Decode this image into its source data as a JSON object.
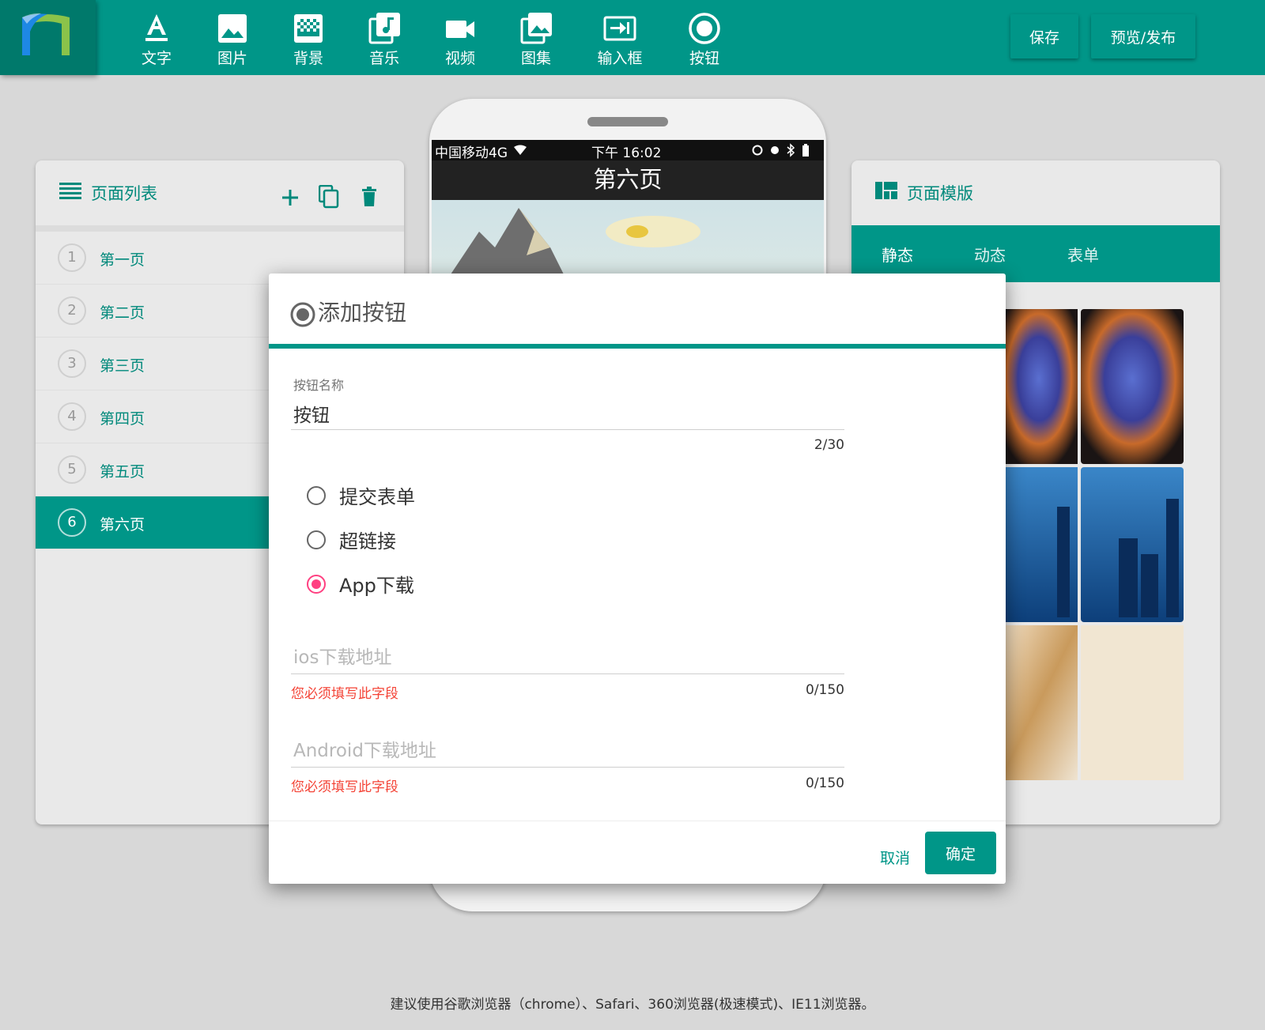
{
  "toolbar": {
    "tools": [
      {
        "label": "文字",
        "icon": "text-icon"
      },
      {
        "label": "图片",
        "icon": "image-icon"
      },
      {
        "label": "背景",
        "icon": "background-icon"
      },
      {
        "label": "音乐",
        "icon": "music-icon"
      },
      {
        "label": "视频",
        "icon": "video-icon"
      },
      {
        "label": "图集",
        "icon": "gallery-icon"
      },
      {
        "label": "输入框",
        "icon": "input-box-icon"
      },
      {
        "label": "按钮",
        "icon": "button-icon"
      }
    ],
    "save_label": "保存",
    "publish_label": "预览/发布"
  },
  "page_list": {
    "title": "页面列表",
    "pages": [
      {
        "num": "1",
        "label": "第一页"
      },
      {
        "num": "2",
        "label": "第二页"
      },
      {
        "num": "3",
        "label": "第三页"
      },
      {
        "num": "4",
        "label": "第四页"
      },
      {
        "num": "5",
        "label": "第五页"
      },
      {
        "num": "6",
        "label": "第六页",
        "active": true
      }
    ]
  },
  "templates": {
    "title": "页面模版",
    "tabs": [
      "静态",
      "动态",
      "表单"
    ]
  },
  "phone": {
    "carrier": "中国移动4G",
    "time": "下午 16:02",
    "page_title": "第六页"
  },
  "dialog": {
    "title": "添加按钮",
    "name_label": "按钮名称",
    "name_value": "按钮",
    "name_counter": "2/30",
    "options": [
      {
        "label": "提交表单",
        "checked": false
      },
      {
        "label": "超链接",
        "checked": false
      },
      {
        "label": "App下载",
        "checked": true
      }
    ],
    "ios_placeholder": "ios下载地址",
    "ios_error": "您必须填写此字段",
    "ios_counter": "0/150",
    "android_placeholder": "Android下载地址",
    "android_error": "您必须填写此字段",
    "android_counter": "0/150",
    "cancel_label": "取消",
    "ok_label": "确定"
  },
  "footer": {
    "note": "建议使用谷歌浏览器（chrome）、Safari、360浏览器(极速模式)、IE11浏览器。"
  },
  "colors": {
    "primary": "#009688",
    "primary_dark": "#00796b",
    "accent": "#ff4081",
    "error": "#f44336"
  }
}
